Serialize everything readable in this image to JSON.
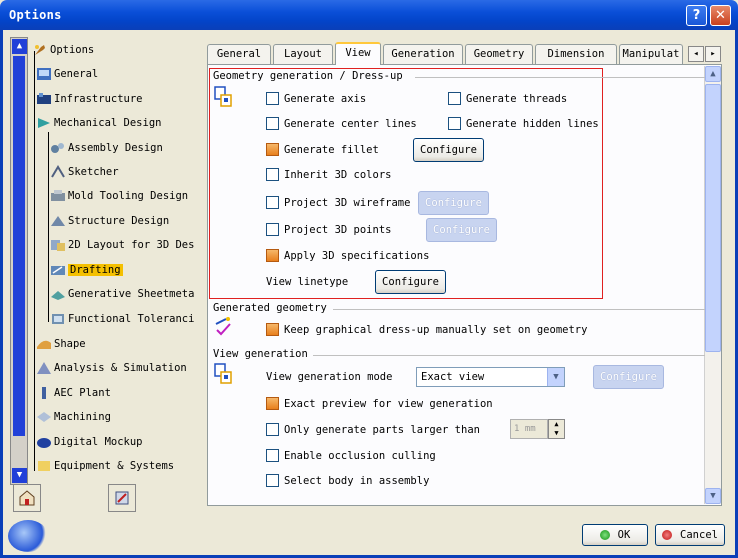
{
  "window": {
    "title": "Options",
    "help_glyph": "?",
    "close_glyph": "✕"
  },
  "tree": {
    "items": [
      {
        "label": "Options",
        "icon": "options-root-icon"
      },
      {
        "label": "General",
        "icon": "general-icon"
      },
      {
        "label": "Infrastructure",
        "icon": "infrastructure-icon"
      },
      {
        "label": "Mechanical Design",
        "icon": "mechanical-design-icon"
      },
      {
        "label": "Assembly Design",
        "icon": "assembly-design-icon"
      },
      {
        "label": "Sketcher",
        "icon": "sketcher-icon"
      },
      {
        "label": "Mold Tooling Design",
        "icon": "mold-tooling-icon"
      },
      {
        "label": "Structure Design",
        "icon": "structure-design-icon"
      },
      {
        "label": "2D Layout for 3D Des",
        "icon": "layout-2d-icon"
      },
      {
        "label": "Drafting",
        "icon": "drafting-icon"
      },
      {
        "label": "Generative Sheetmeta",
        "icon": "sheetmetal-icon"
      },
      {
        "label": "Functional Toleranci",
        "icon": "tolerancing-icon"
      },
      {
        "label": "Shape",
        "icon": "shape-icon"
      },
      {
        "label": "Analysis & Simulation",
        "icon": "analysis-icon"
      },
      {
        "label": "AEC Plant",
        "icon": "aec-plant-icon"
      },
      {
        "label": "Machining",
        "icon": "machining-icon"
      },
      {
        "label": "Digital Mockup",
        "icon": "digital-mockup-icon"
      },
      {
        "label": "Equipment & Systems",
        "icon": "equipment-icon"
      }
    ],
    "selected": "Drafting"
  },
  "tabs": [
    {
      "label": "General"
    },
    {
      "label": "Layout"
    },
    {
      "label": "View"
    },
    {
      "label": "Generation"
    },
    {
      "label": "Geometry"
    },
    {
      "label": "Dimension"
    },
    {
      "label": "Manipulat"
    }
  ],
  "active_tab": "View",
  "tab_scroll": {
    "left": "◂",
    "right": "▸"
  },
  "geometry_section": {
    "title": "Geometry generation / Dress-up",
    "generate_axis": "Generate axis",
    "generate_threads": "Generate threads",
    "generate_center_lines": "Generate center lines",
    "generate_hidden_lines": "Generate hidden lines",
    "generate_fillet": "Generate fillet",
    "inherit_3d_colors": "Inherit 3D colors",
    "project_3d_wireframe": "Project 3D wireframe",
    "project_3d_points": "Project 3D points",
    "apply_3d_specifications": "Apply 3D specifications",
    "view_linetype": "View linetype",
    "configure": "Configure"
  },
  "generated_section": {
    "title": "Generated geometry",
    "keep_dressup": "Keep graphical dress-up manually set on geometry"
  },
  "view_gen_section": {
    "title": "View generation",
    "mode_label": "View generation mode",
    "mode_value": "Exact view",
    "configure": "Configure",
    "exact_preview": "Exact preview for view generation",
    "only_larger": "Only generate parts larger than",
    "size_value": "1 mm",
    "occlusion": "Enable occlusion culling",
    "select_body": "Select body in assembly"
  },
  "footer": {
    "ok": "OK",
    "cancel": "Cancel"
  },
  "colors": {
    "title_bar": "#0a4fd8",
    "selection": "#f4c000",
    "checked": "#e87f1c",
    "highlight_frame": "#e02020"
  }
}
